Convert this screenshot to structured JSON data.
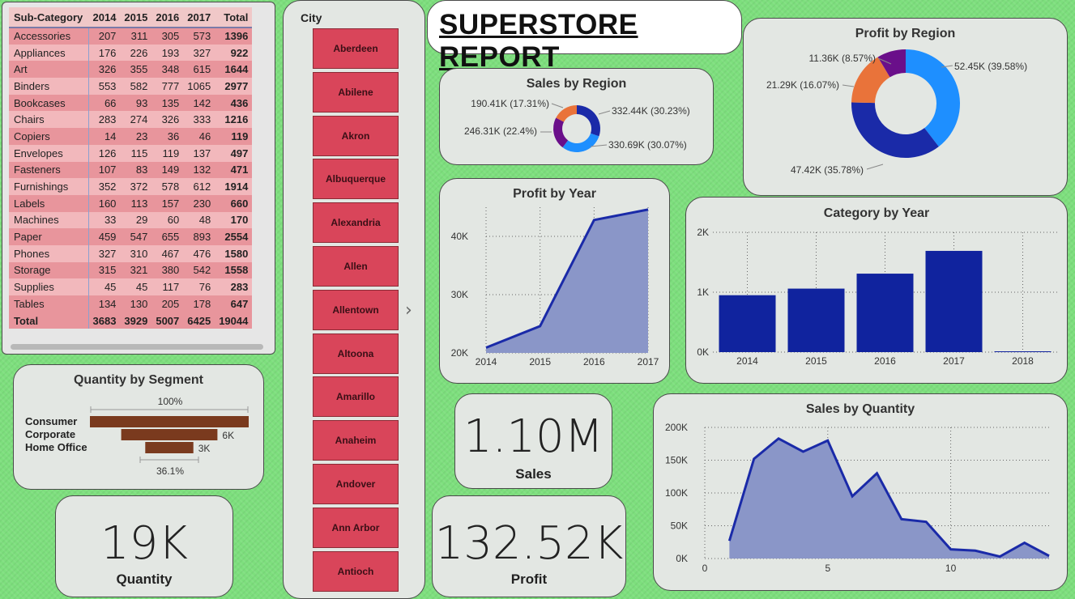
{
  "matrix": {
    "headers": [
      "Sub-Category",
      "2014",
      "2015",
      "2016",
      "2017",
      "Total"
    ],
    "rows": [
      [
        "Accessories",
        "207",
        "311",
        "305",
        "573",
        "1396"
      ],
      [
        "Appliances",
        "176",
        "226",
        "193",
        "327",
        "922"
      ],
      [
        "Art",
        "326",
        "355",
        "348",
        "615",
        "1644"
      ],
      [
        "Binders",
        "553",
        "582",
        "777",
        "1065",
        "2977"
      ],
      [
        "Bookcases",
        "66",
        "93",
        "135",
        "142",
        "436"
      ],
      [
        "Chairs",
        "283",
        "274",
        "326",
        "333",
        "1216"
      ],
      [
        "Copiers",
        "14",
        "23",
        "36",
        "46",
        "119"
      ],
      [
        "Envelopes",
        "126",
        "115",
        "119",
        "137",
        "497"
      ],
      [
        "Fasteners",
        "107",
        "83",
        "149",
        "132",
        "471"
      ],
      [
        "Furnishings",
        "352",
        "372",
        "578",
        "612",
        "1914"
      ],
      [
        "Labels",
        "160",
        "113",
        "157",
        "230",
        "660"
      ],
      [
        "Machines",
        "33",
        "29",
        "60",
        "48",
        "170"
      ],
      [
        "Paper",
        "459",
        "547",
        "655",
        "893",
        "2554"
      ],
      [
        "Phones",
        "327",
        "310",
        "467",
        "476",
        "1580"
      ],
      [
        "Storage",
        "315",
        "321",
        "380",
        "542",
        "1558"
      ],
      [
        "Supplies",
        "45",
        "45",
        "117",
        "76",
        "283"
      ],
      [
        "Tables",
        "134",
        "130",
        "205",
        "178",
        "647"
      ]
    ],
    "total": [
      "Total",
      "3683",
      "3929",
      "5007",
      "6425",
      "19044"
    ]
  },
  "slicer": {
    "label": "City",
    "cities": [
      "Aberdeen",
      "Abilene",
      "Akron",
      "Albuquerque",
      "Alexandria",
      "Allen",
      "Allentown",
      "Altoona",
      "Amarillo",
      "Anaheim",
      "Andover",
      "Ann Arbor",
      "Antioch"
    ]
  },
  "title": "SUPERSTORE REPORT",
  "kpis": {
    "sales_value": "1.10M",
    "sales_label": "Sales",
    "profit_value": "132.52K",
    "profit_label": "Profit",
    "quantity_value": "19K",
    "quantity_label": "Quantity"
  },
  "colors": {
    "navy": "#1a2aa8",
    "area": "#8a96c8",
    "blue": "#1e8fff",
    "orange": "#e9733a",
    "purple": "#6a0f8a",
    "bar": "#7a3a1e",
    "slicer": "#d9455a"
  },
  "chart_data": [
    {
      "type": "pie",
      "title": "Sales by Region",
      "labels": [
        "332.44K (30.23%)",
        "330.69K (30.07%)",
        "246.31K (22.4%)",
        "190.41K (17.31%)"
      ],
      "values": [
        332.44,
        330.69,
        246.31,
        190.41
      ],
      "colors": [
        "#1a2aa8",
        "#1e8fff",
        "#6a0f8a",
        "#e9733a"
      ]
    },
    {
      "type": "pie",
      "title": "Profit by Region",
      "labels": [
        "52.45K (39.58%)",
        "47.42K (35.78%)",
        "21.29K (16.07%)",
        "11.36K (8.57%)"
      ],
      "values": [
        52.45,
        47.42,
        21.29,
        11.36
      ],
      "colors": [
        "#1e8fff",
        "#1a2aa8",
        "#e9733a",
        "#6a0f8a"
      ]
    },
    {
      "type": "area",
      "title": "Profit by Year",
      "x": [
        2014,
        2015,
        2016,
        2017
      ],
      "y": [
        20.9,
        24.6,
        42.8,
        44.6
      ],
      "ylim": [
        20,
        45
      ],
      "yticks": [
        "20K",
        "30K",
        "40K"
      ],
      "xticks": [
        "2014",
        "2015",
        "2016",
        "2017"
      ]
    },
    {
      "type": "bar",
      "title": "Category by Year",
      "categories": [
        "2014",
        "2015",
        "2016",
        "2017",
        "2018"
      ],
      "values": [
        0.95,
        1.06,
        1.31,
        1.69,
        0.01
      ],
      "ylim": [
        0,
        2
      ],
      "yticks": [
        "0K",
        "1K",
        "2K"
      ]
    },
    {
      "type": "area",
      "title": "Sales by Quantity",
      "x": [
        1,
        2,
        3,
        4,
        5,
        6,
        7,
        8,
        9,
        10,
        11,
        12,
        13,
        14
      ],
      "y": [
        27,
        152,
        183,
        163,
        180,
        95,
        130,
        60,
        56,
        14,
        12,
        3,
        24,
        4
      ],
      "xlim": [
        0,
        14
      ],
      "ylim": [
        0,
        200
      ],
      "yticks": [
        "0K",
        "50K",
        "100K",
        "150K",
        "200K"
      ],
      "xticks": [
        "0",
        "5",
        "10"
      ]
    },
    {
      "type": "bar",
      "title": "Quantity by Segment",
      "categories": [
        "Consumer",
        "Corporate",
        "Home Office"
      ],
      "values": [
        9.9,
        6,
        3
      ],
      "labels": [
        "",
        "6K",
        "3K"
      ],
      "top_pct": "100%",
      "bottom_pct": "36.1%"
    }
  ]
}
